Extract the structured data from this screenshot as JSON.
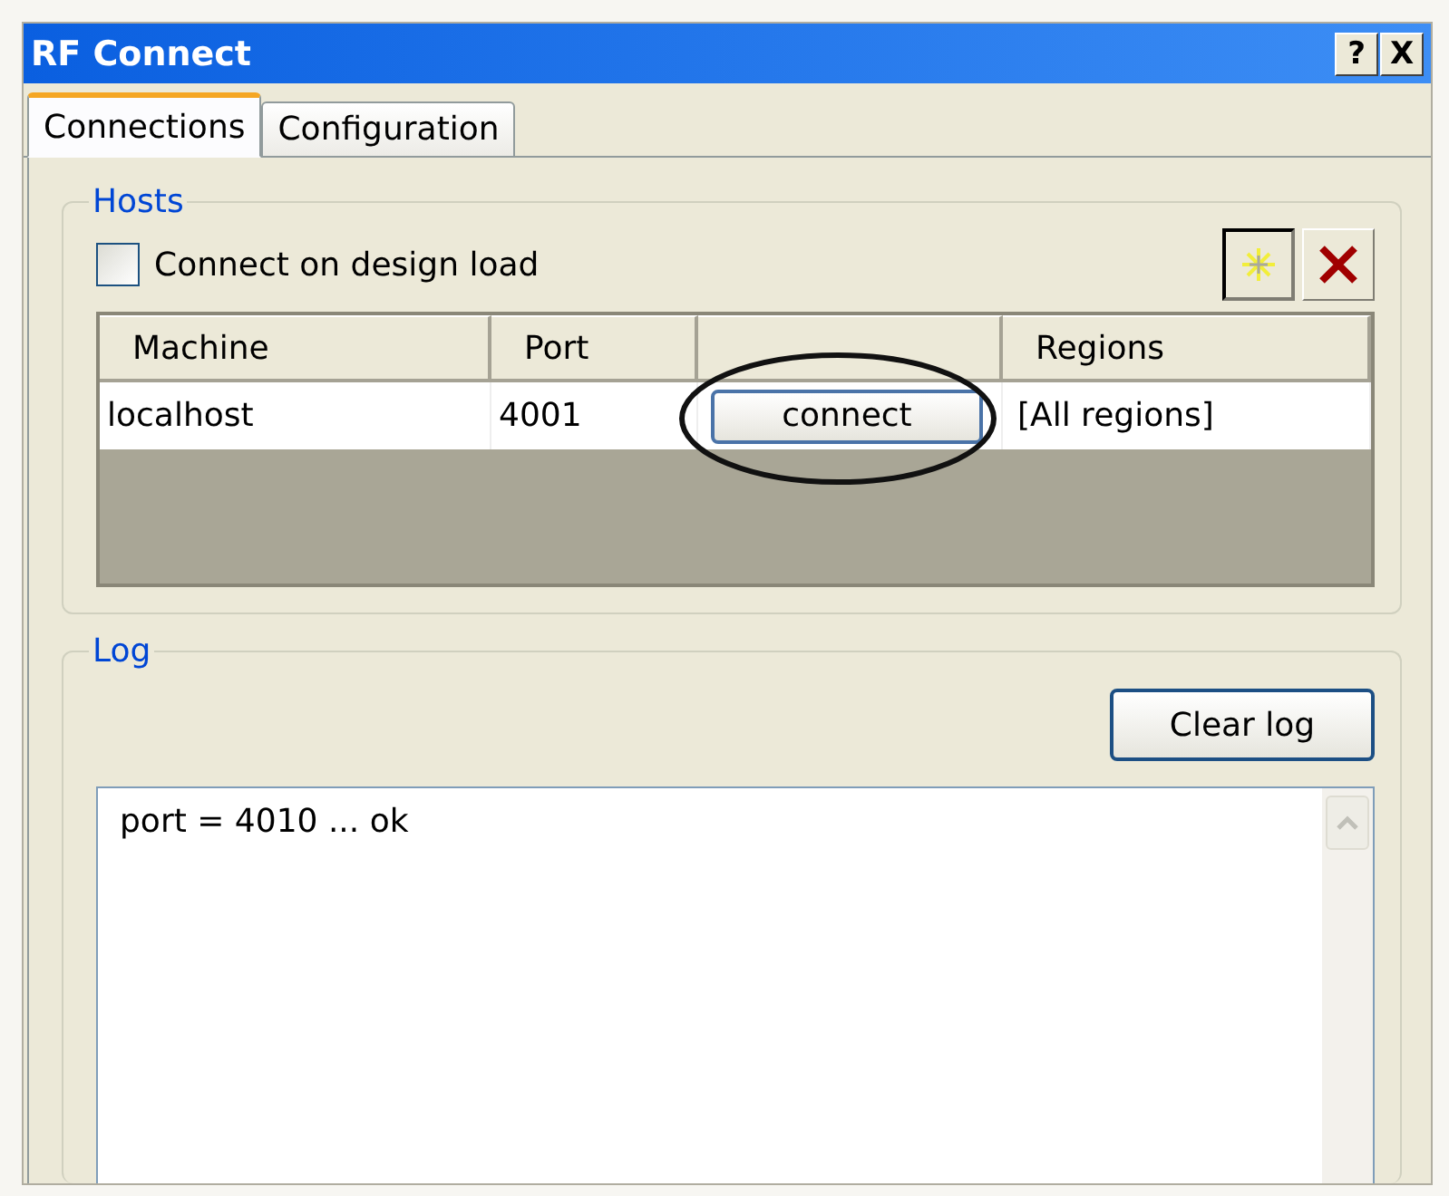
{
  "window": {
    "title": "RF Connect",
    "buttons": [
      "?",
      "X"
    ]
  },
  "tabs": [
    {
      "label": "Connections",
      "selected": true
    },
    {
      "label": "Configuration",
      "selected": false
    }
  ],
  "hosts": {
    "title": "Hosts",
    "connect_on_load": {
      "label": "Connect on design load",
      "checked": false
    },
    "columns": [
      "Machine",
      "Port",
      "",
      "Regions"
    ],
    "rows": [
      {
        "machine": "localhost",
        "port": "4001",
        "action": "connect",
        "regions": "[All regions]"
      }
    ]
  },
  "log": {
    "title": "Log",
    "clear_button": "Clear log",
    "lines": [
      "port = 4010 ... ok"
    ]
  }
}
